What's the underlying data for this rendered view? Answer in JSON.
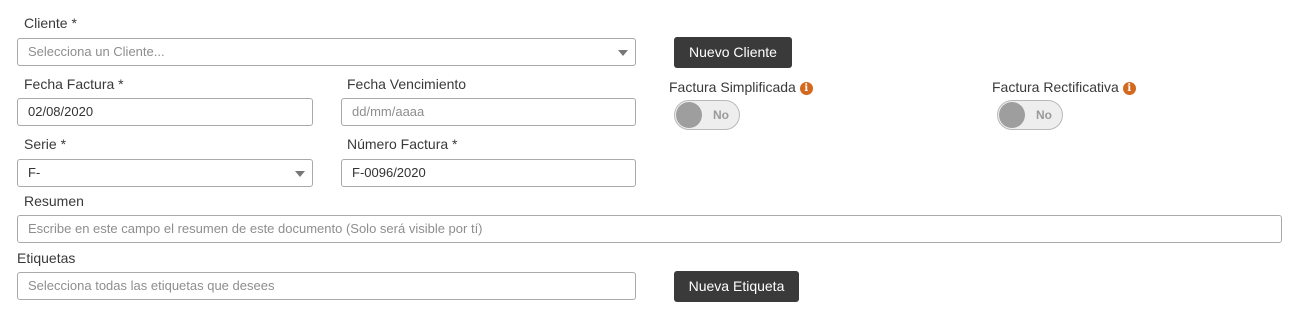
{
  "client": {
    "label": "Cliente *",
    "placeholder": "Selecciona un Cliente...",
    "new_button": "Nuevo Cliente"
  },
  "invoice_date": {
    "label": "Fecha Factura *",
    "value": "02/08/2020"
  },
  "due_date": {
    "label": "Fecha Vencimiento",
    "placeholder": "dd/mm/aaaa"
  },
  "simplified": {
    "label": "Factura Simplificada",
    "toggle": "No",
    "info": "i"
  },
  "rectifying": {
    "label": "Factura Rectificativa",
    "toggle": "No",
    "info": "i"
  },
  "series": {
    "label": "Serie *",
    "value": "F-"
  },
  "invoice_number": {
    "label": "Número Factura *",
    "value": "F-0096/2020"
  },
  "summary": {
    "label": "Resumen",
    "placeholder": "Escribe en este campo el resumen de este documento (Solo será visible por tí)"
  },
  "tags": {
    "label": "Etiquetas",
    "placeholder": "Selecciona todas las etiquetas que desees",
    "new_button": "Nueva Etiqueta"
  },
  "colors": {
    "button_bg": "#3a3a3a",
    "info_icon": "#d2691e",
    "toggle_knob": "#9e9e9e"
  },
  "icons": {
    "select_caret": "caret-down-icon",
    "info": "info-icon"
  }
}
